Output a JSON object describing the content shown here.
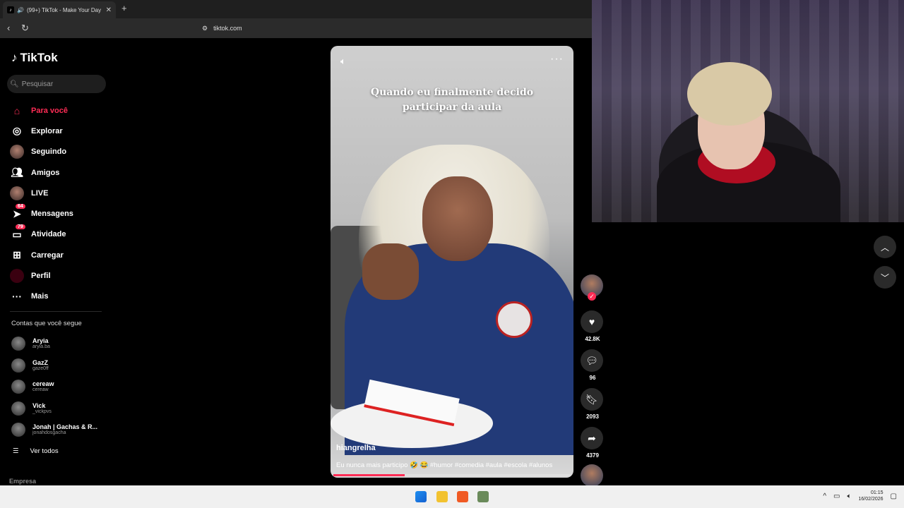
{
  "browser": {
    "tab_title": "(99+) TikTok - Make Your Day",
    "url": "tiktok.com"
  },
  "sidebar": {
    "brand": "TikTok",
    "search_placeholder": "Pesquisar",
    "nav": [
      {
        "label": "Para você",
        "icon": "home-icon",
        "active": true
      },
      {
        "label": "Explorar",
        "icon": "compass-icon"
      },
      {
        "label": "Seguindo",
        "icon": "following-avatar-icon"
      },
      {
        "label": "Amigos",
        "icon": "friends-icon"
      },
      {
        "label": "LIVE",
        "icon": "live-avatar-icon"
      },
      {
        "label": "Mensagens",
        "icon": "messages-icon",
        "badge": "64"
      },
      {
        "label": "Atividade",
        "icon": "activity-icon",
        "badge": "79"
      },
      {
        "label": "Carregar",
        "icon": "upload-icon"
      },
      {
        "label": "Perfil",
        "icon": "profile-icon"
      },
      {
        "label": "Mais",
        "icon": "more-icon"
      }
    ],
    "following_header": "Contas que você segue",
    "following": [
      {
        "name": "Aryia",
        "handle": "aryia.ba"
      },
      {
        "name": "GazZ",
        "handle": "gaze0ff"
      },
      {
        "name": "cereaw",
        "handle": "cereaw"
      },
      {
        "name": "Vick",
        "handle": "_vickpvs"
      },
      {
        "name": "Jonah | Gachas & R...",
        "handle": "jonahdosgacha"
      }
    ],
    "see_all": "Ver todos",
    "footer": "Empresa"
  },
  "video": {
    "caption_line1": "Quando eu finalmente decido",
    "caption_line2": "participar da aula",
    "author": "hiangrelha",
    "description": "Eu nunca mais participo 🤣 😂 #humor #comedia #aula #escola #alunos",
    "progress": 0.3
  },
  "actions": {
    "likes": "42.8K",
    "comments": "96",
    "saves": "2093",
    "shares": "4379"
  },
  "taskbar": {
    "time": "01:15",
    "date": "16/02/2026"
  },
  "colors": {
    "accent": "#fe2c55",
    "background": "#000000"
  }
}
